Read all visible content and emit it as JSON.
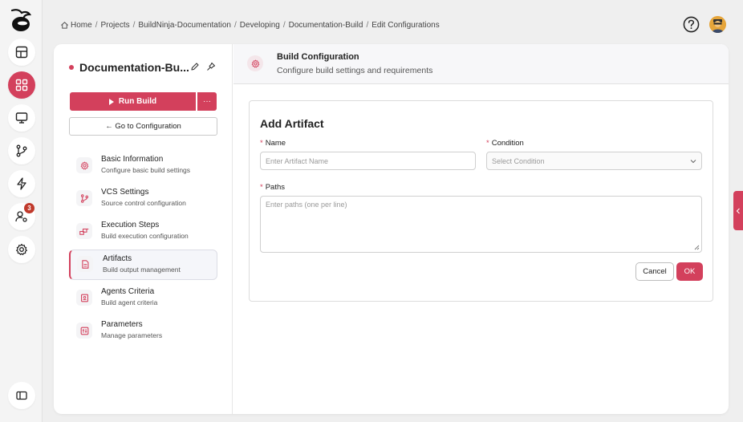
{
  "breadcrumb": [
    "Home",
    "Projects",
    "BuildNinja-Documentation",
    "Developing",
    "Documentation-Build",
    "Edit Configurations"
  ],
  "rail": {
    "items": [
      "dashboard-icon",
      "projects-icon",
      "monitor-icon",
      "branch-icon",
      "lightning-icon",
      "user-settings-icon",
      "settings-icon",
      "sidebar-toggle-icon"
    ],
    "active": "projects-icon",
    "notification_count": "3"
  },
  "project": {
    "name": "Documentation-Bu..."
  },
  "actions": {
    "run_label": "Run Build",
    "more_label": "···",
    "goto_label": "← Go to Configuration"
  },
  "nav": {
    "items": [
      {
        "title": "Basic Information",
        "subtitle": "Configure basic build settings",
        "icon": "gear-icon"
      },
      {
        "title": "VCS Settings",
        "subtitle": "Source control configuration",
        "icon": "branch-icon"
      },
      {
        "title": "Execution Steps",
        "subtitle": "Build execution configuration",
        "icon": "steps-icon"
      },
      {
        "title": "Artifacts",
        "subtitle": "Build output management",
        "icon": "file-icon"
      },
      {
        "title": "Agents Criteria",
        "subtitle": "Build agent criteria",
        "icon": "agent-icon"
      },
      {
        "title": "Parameters",
        "subtitle": "Manage parameters",
        "icon": "parameters-icon"
      }
    ],
    "active_index": 3
  },
  "header": {
    "title": "Build Configuration",
    "subtitle": "Configure build settings and requirements"
  },
  "form": {
    "title": "Add Artifact",
    "required_mark": "*",
    "name_label": "Name",
    "name_placeholder": "Enter Artifact Name",
    "condition_label": "Condition",
    "condition_placeholder": "Select Condition",
    "paths_label": "Paths",
    "paths_placeholder": "Enter paths (one per line)",
    "cancel_label": "Cancel",
    "ok_label": "OK"
  },
  "colors": {
    "accent": "#d3405c",
    "badge": "#c0392b"
  }
}
